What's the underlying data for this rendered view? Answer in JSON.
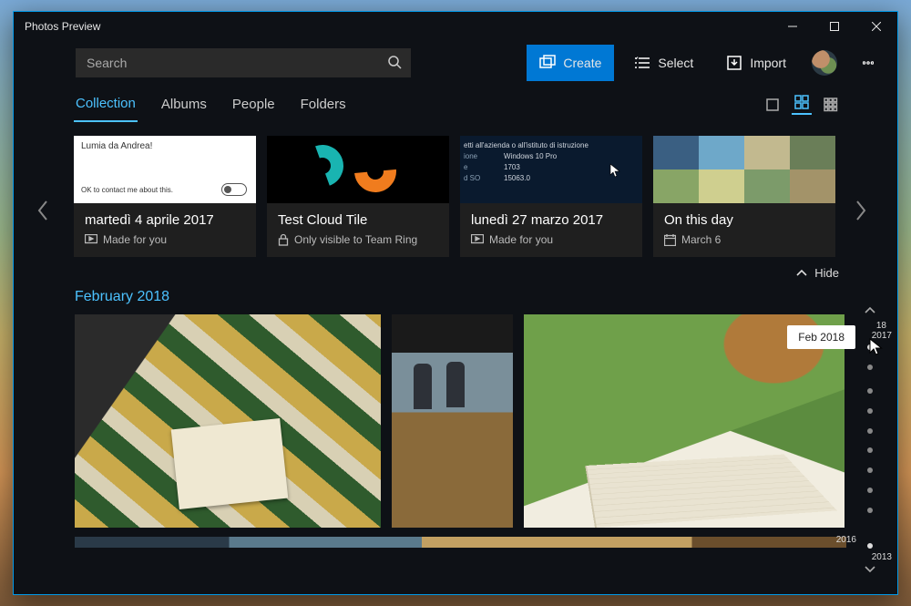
{
  "window": {
    "title": "Photos Preview"
  },
  "search": {
    "placeholder": "Search"
  },
  "commands": {
    "create": "Create",
    "select": "Select",
    "import": "Import"
  },
  "tabs": {
    "collection": "Collection",
    "albums": "Albums",
    "people": "People",
    "folders": "Folders"
  },
  "tiles": [
    {
      "thumb": {
        "line1": "Lumia da Andrea!",
        "line2": "OK to contact me about this."
      },
      "title": "martedì 4 aprile 2017",
      "meta": "Made for you",
      "metaIcon": "slideshow"
    },
    {
      "title": "Test Cloud Tile",
      "meta": "Only visible to Team Ring",
      "metaIcon": "lock"
    },
    {
      "thumb": {
        "hdr": "etti all'azienda o all'istituto di istruzione",
        "rows": [
          {
            "k": "ione",
            "v": "Windows 10 Pro"
          },
          {
            "k": "e",
            "v": "1703"
          },
          {
            "k": "d SO",
            "v": "15063.0"
          }
        ]
      },
      "title": "lunedì 27 marzo 2017",
      "meta": "Made for you",
      "metaIcon": "slideshow"
    },
    {
      "title": "On this day",
      "meta": "March 6",
      "metaIcon": "calendar"
    }
  ],
  "hide": "Hide",
  "section": {
    "title": "February 2018"
  },
  "timeline": {
    "tooltip": "Feb 2018",
    "years": {
      "top1": "18",
      "top2": "2017",
      "bot1": "2016",
      "bot2": "2013"
    }
  }
}
